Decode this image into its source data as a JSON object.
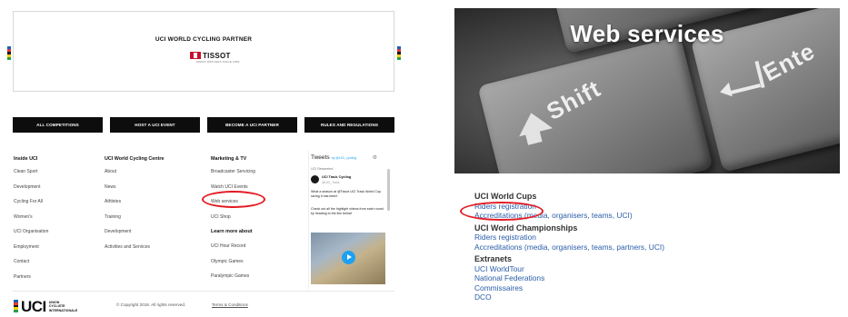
{
  "left": {
    "partner": {
      "title": "UCI WORLD CYCLING PARTNER",
      "logo_text": "TISSOT",
      "logo_tagline": "SWISS WATCHES SINCE 1853"
    },
    "rainbow_colors": [
      "#1f5fae",
      "#e03a3e",
      "#1a1a1a",
      "#f5d10f",
      "#2a9d4b"
    ],
    "nav_buttons": [
      "ALL COMPETITIONS",
      "HOST A UCI EVENT",
      "BECOME A UCI PARTNER",
      "RULES AND REGULATIONS"
    ],
    "columns": [
      {
        "heading": "Inside UCI",
        "items": [
          "Clean Sport",
          "Development",
          "Cycling For All",
          "Women's",
          "UCI Organisation",
          "Employment",
          "Contact",
          "Partners"
        ]
      },
      {
        "heading": "UCI World Cycling Centre",
        "items": [
          "About",
          "News",
          "Athletes",
          "Training",
          "Development",
          "Activities and Services"
        ]
      },
      {
        "heading": "Marketing & TV",
        "items": [
          "Broadcaster Servicing",
          "Watch UCI Events",
          "Web services",
          "UCI Shop"
        ],
        "subheading": "Learn more about",
        "sub_items": [
          "UCI Hour Record",
          "Olympic Games",
          "Paralympic Games"
        ]
      }
    ],
    "tweets": {
      "title": "Tweets",
      "by": "by @UCI_cycling",
      "retweet": "UCI Retweeted",
      "account_name": "UCI Track Cycling",
      "account_handle": "@UCI_Track",
      "text1": "What a season at @Tissot UCI Track World Cup racing it has been!",
      "text2": "Check out all the highlight videos from each round by heading to the link below!"
    },
    "footer": {
      "logo_letters": "UCI",
      "logo_small": [
        "UNION",
        "CYCLISTE",
        "INTERNATIONALE"
      ],
      "copyright": "© Copyright 2018. All rights reserved.",
      "terms": "Terms & Conditions"
    }
  },
  "right": {
    "hero_title": "Web services",
    "key_shift": "Shift",
    "key_enter": "Ente",
    "sections": [
      {
        "heading": "UCI World Cups",
        "links": [
          "Riders registration",
          "Accreditations (media, organisers, teams, UCI)"
        ]
      },
      {
        "heading": "UCI World Championships",
        "links": [
          "Riders registration",
          "Accreditations (media, organisers, teams, partners, UCI)"
        ]
      },
      {
        "heading": "Extranets",
        "links": [
          "UCI WorldTour",
          "National Federations",
          "Commissaires",
          "DCO"
        ]
      }
    ]
  },
  "colors": {
    "highlight_red": "#e31b23",
    "link_blue": "#2a5da8",
    "nav_black": "#0d0d0d"
  }
}
